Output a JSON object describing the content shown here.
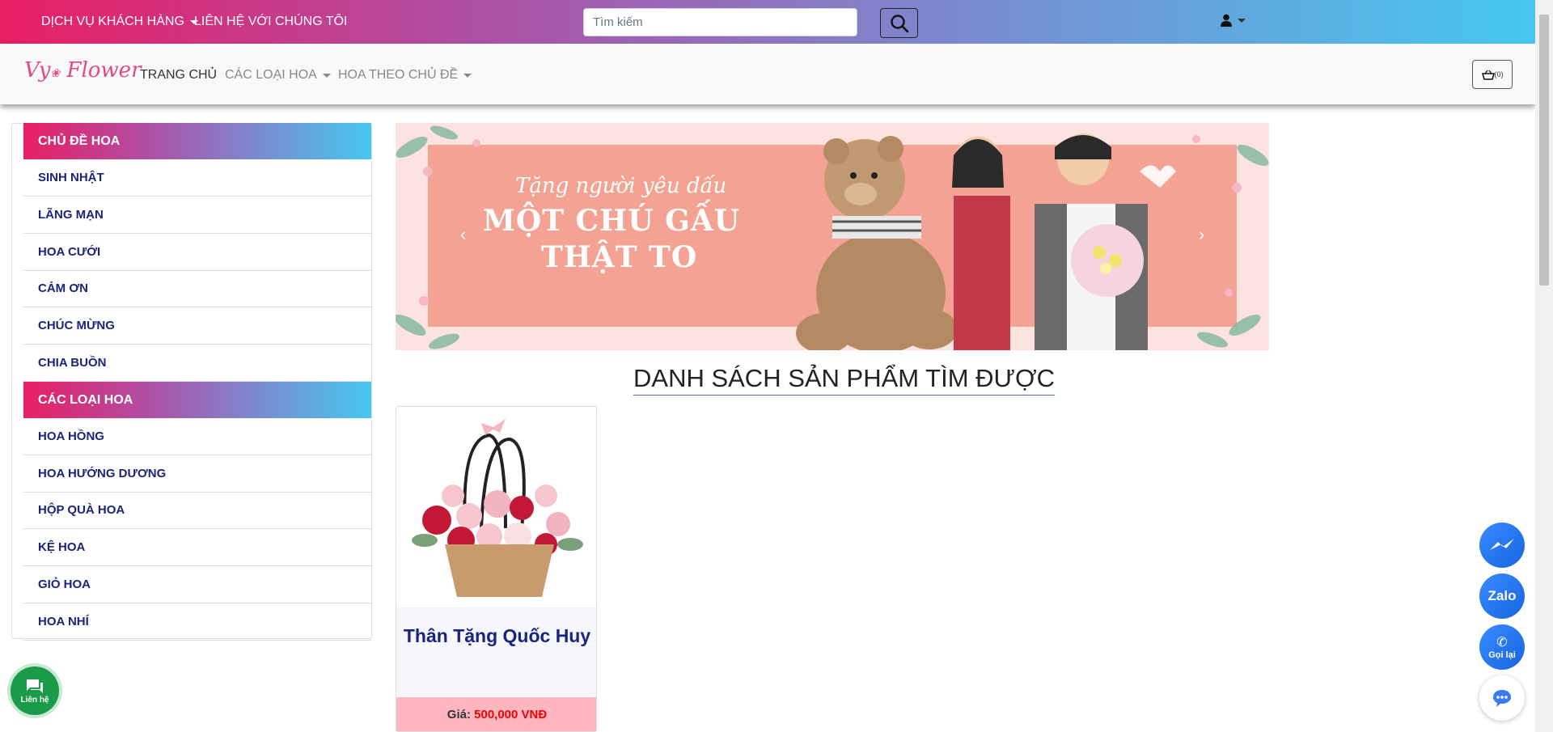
{
  "topbar": {
    "customer_service": "DỊCH VỤ KHÁCH HÀNG",
    "contact_us": "LIÊN HỆ VỚI CHÚNG TÔI",
    "search_placeholder": "Tìm kiếm"
  },
  "navbar": {
    "logo_left": "Vy",
    "logo_right": "Flower",
    "home": "TRANG CHỦ",
    "flower_types": "CÁC LOẠI HOA",
    "flower_themes": "HOA THEO CHỦ ĐỀ",
    "cart_count": "(0)"
  },
  "sidebar": {
    "themes_header": "CHỦ ĐỀ HOA",
    "themes": [
      "SINH NHẬT",
      "LÃNG MẠN",
      "HOA CƯỚI",
      "CẢM ƠN",
      "CHÚC MỪNG",
      "CHIA BUỒN"
    ],
    "types_header": "CÁC LOẠI HOA",
    "types": [
      "HOA HỒNG",
      "HOA HƯỚNG DƯƠNG",
      "HỘP QUÀ HOA",
      "KỆ HOA",
      "GIỎ HOA",
      "HOA NHÍ"
    ]
  },
  "banner": {
    "line1": "Tặng người yêu dấu",
    "line2": "MỘT CHÚ GẤU",
    "line3": "THẬT TO"
  },
  "main": {
    "section_title": "DANH SÁCH SẢN PHẨM TÌM ĐƯỢC",
    "products": [
      {
        "name": "Thân Tặng Quốc Huy",
        "price_label": "Giá:",
        "price": "500,000 VNĐ"
      }
    ]
  },
  "floating": {
    "zalo": "Zalo",
    "call_back": "Gọi lại",
    "contact": "Liên hệ"
  },
  "colors": {
    "gradient_start": "#e91e63",
    "gradient_end": "#45c8f0",
    "nav_text": "#1a237e",
    "price": "#ee0000"
  }
}
